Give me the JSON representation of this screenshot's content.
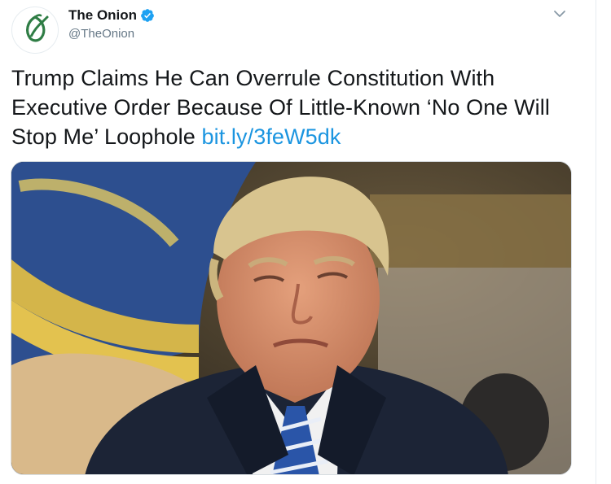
{
  "account": {
    "display_name": "The Onion",
    "handle": "@TheOnion",
    "verified": true,
    "avatar_icon": "onion-logo-icon"
  },
  "tweet": {
    "text": "Trump Claims He Can Overrule Constitution With Executive Order Because Of Little-Known ‘No One Will Stop Me’ Loophole",
    "link": "bit.ly/3feW5dk"
  },
  "media": {
    "type": "photo"
  },
  "colors": {
    "link": "#1b95e0",
    "verified_badge": "#1da1f2",
    "brand_green": "#006b3c",
    "handle_gray": "#657786"
  },
  "icons": {
    "verified": "verified-badge-icon",
    "menu": "chevron-down-icon"
  }
}
